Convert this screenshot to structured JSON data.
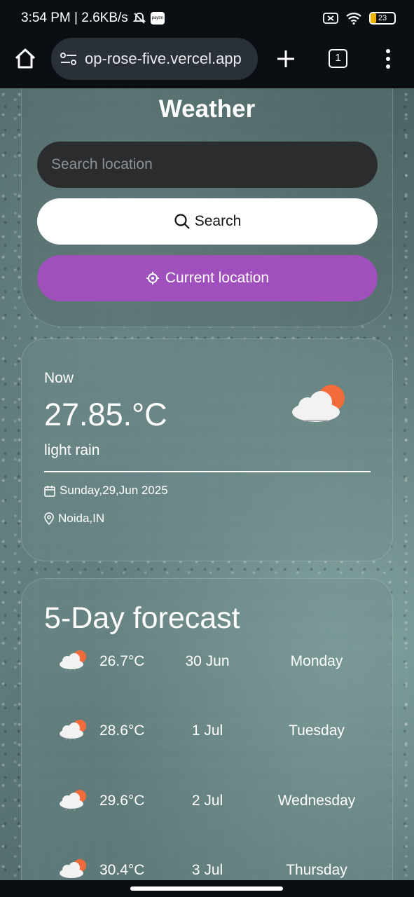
{
  "status_bar": {
    "time_speed": "3:54 PM | 2.6KB/s",
    "battery_level": "23"
  },
  "browser": {
    "url": "op-rose-five.vercel.app",
    "tab_count": "1"
  },
  "app": {
    "title": "Weather",
    "search_placeholder": "Search location",
    "search_label": "Search",
    "location_label": "Current location"
  },
  "current": {
    "now_label": "Now",
    "temperature": "27.85.°C",
    "condition": "light rain",
    "date": "Sunday,29,Jun 2025",
    "location": "Noida,IN"
  },
  "forecast": {
    "title": "5-Day forecast",
    "days": [
      {
        "temp": "26.7°C",
        "date": "30 Jun",
        "day": "Monday"
      },
      {
        "temp": "28.6°C",
        "date": "1 Jul",
        "day": "Tuesday"
      },
      {
        "temp": "29.6°C",
        "date": "2 Jul",
        "day": "Wednesday"
      },
      {
        "temp": "30.4°C",
        "date": "3 Jul",
        "day": "Thursday"
      }
    ]
  },
  "colors": {
    "accent_purple": "#a050bd",
    "sun_orange": "#f26b3a"
  }
}
